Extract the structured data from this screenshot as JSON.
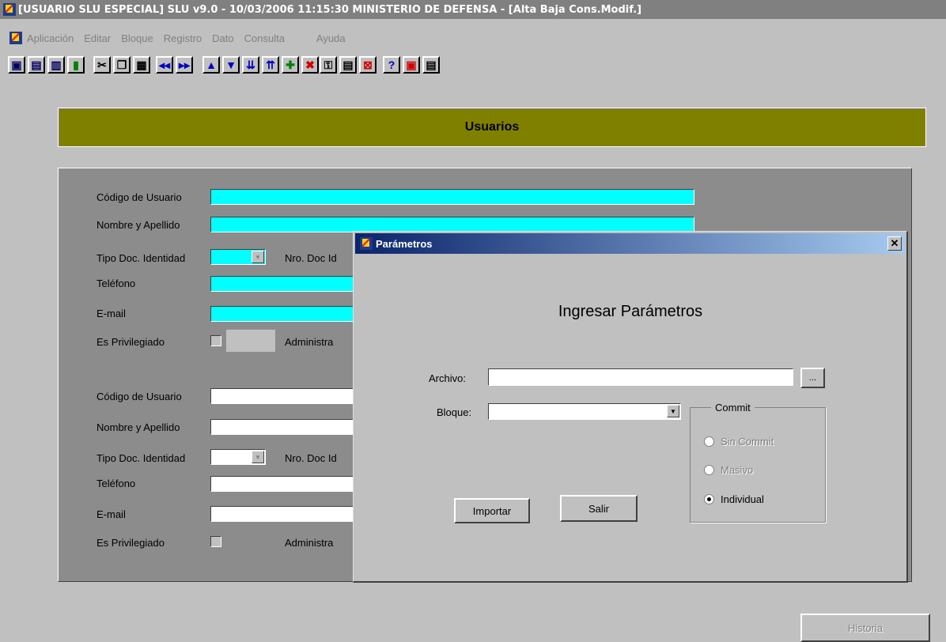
{
  "window": {
    "title": "[USUARIO SLU ESPECIAL]  SLU v9.0 - 10/03/2006 11:15:30 MINISTERIO DE DEFENSA - [Alta Baja Cons.Modif.]"
  },
  "menu": {
    "items": [
      "Aplicación",
      "Editar",
      "Bloque",
      "Registro",
      "Dato",
      "Consulta",
      "Ayuda"
    ]
  },
  "toolbar": {
    "icons": [
      "save-icon",
      "print-icon",
      "print-preview-icon",
      "exit-door-icon",
      "cut-icon",
      "copy-icon",
      "paste-icon",
      "previous-block-icon",
      "next-block-icon",
      "previous-record-icon",
      "next-record-icon",
      "last-record-icon",
      "first-record-icon",
      "insert-record-icon",
      "delete-record-icon",
      "enter-query-icon",
      "execute-query-icon",
      "cancel-query-icon",
      "help-icon",
      "list-values-icon",
      "display-error-icon"
    ]
  },
  "header": {
    "title": "Usuarios"
  },
  "form": {
    "section1": {
      "codigo_label": "Código de Usuario",
      "nombre_label": "Nombre y Apellido",
      "tipo_doc_label": "Tipo Doc. Identidad",
      "nro_doc_label": "Nro. Doc Id",
      "telefono_label": "Teléfono",
      "email_label": "E-mail",
      "privilegiado_label": "Es Privilegiado",
      "administra_label": "Administra"
    },
    "section2": {
      "codigo_label": "Código de Usuario",
      "nombre_label": "Nombre y Apellido",
      "tipo_doc_label": "Tipo Doc. Identidad",
      "nro_doc_label": "Nro. Doc Id",
      "telefono_label": "Teléfono",
      "email_label": "E-mail",
      "privilegiado_label": "Es Privilegiado",
      "administra_label": "Administra"
    },
    "historia_button": "Historia"
  },
  "dialog": {
    "title": "Parámetros",
    "heading": "Ingresar Parámetros",
    "archivo_label": "Archivo:",
    "archivo_value": "",
    "browse_button": "...",
    "bloque_label": "Bloque:",
    "bloque_value": "",
    "commit_group_label": "Commit",
    "commit_options": [
      "Sin Commit",
      "Masivo",
      "Individual"
    ],
    "commit_selected": "Individual",
    "importar_button": "Importar",
    "salir_button": "Salir"
  },
  "colors": {
    "header_band": "#808000",
    "required_field": "#00ffff",
    "form_background": "#8c8c8c",
    "window_background": "#c0c0c0"
  }
}
